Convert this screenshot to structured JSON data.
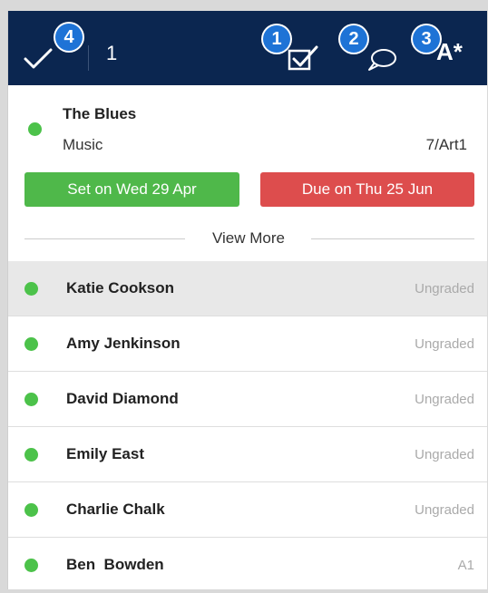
{
  "toolbar": {
    "selected_count": "1",
    "badges": [
      "4",
      "1",
      "2",
      "3"
    ],
    "icons": [
      "check-icon",
      "mark-complete-icon",
      "comment-icon",
      "grade-icon"
    ],
    "grade_glyph": "A*"
  },
  "assignment": {
    "title": "The Blues",
    "subject": "Music",
    "class_code": "7/Art1",
    "set_label": "Set on Wed 29 Apr",
    "due_label": "Due on Thu 25 Jun",
    "view_more": "View More"
  },
  "students": [
    {
      "name": "Katie Cookson",
      "grade": "Ungraded",
      "selected": true
    },
    {
      "name": "Amy Jenkinson",
      "grade": "Ungraded"
    },
    {
      "name": "David Diamond",
      "grade": "Ungraded"
    },
    {
      "name": "Emily East",
      "grade": "Ungraded"
    },
    {
      "name": "Charlie Chalk",
      "grade": "Ungraded"
    },
    {
      "name": "Ben  Bowden",
      "grade": "A1"
    }
  ],
  "colors": {
    "header": "#0b2650",
    "badge": "#1e73d6",
    "status_dot": "#4cc24a",
    "set_pill": "#4fb84a",
    "due_pill": "#dd4d4d"
  }
}
